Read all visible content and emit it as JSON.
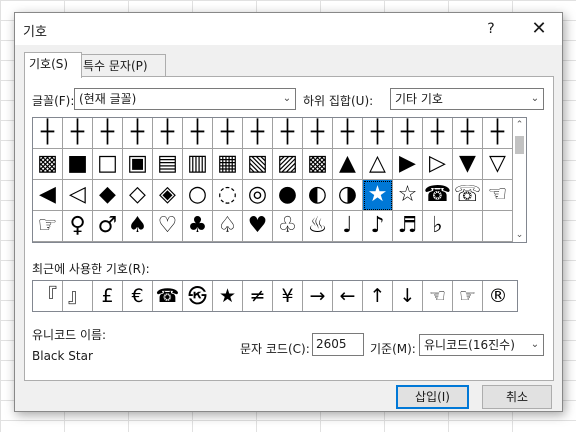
{
  "dialog": {
    "title": "기호",
    "help": "?",
    "close": "✕"
  },
  "tabs": [
    {
      "label": "기호(S)",
      "active": true
    },
    {
      "label": "특수 문자(P)",
      "active": false
    }
  ],
  "font": {
    "label": "글꼴(F):",
    "value": "(현재 글꼴)"
  },
  "subset": {
    "label": "하위 집합(U):",
    "value": "기타 기호"
  },
  "symbols": {
    "rows": [
      [
        "┼",
        "┼",
        "┼",
        "┼",
        "┼",
        "┼",
        "┼",
        "┼",
        "┼",
        "┼",
        "┼",
        "┼",
        "┼",
        "┼",
        "┼",
        "┼"
      ],
      [
        "▩",
        "■",
        "□",
        "▣",
        "▤",
        "▥",
        "▦",
        "▧",
        "▨",
        "▩",
        "▲",
        "△",
        "▶",
        "▷",
        "▼",
        "▽"
      ],
      [
        "◀",
        "◁",
        "◆",
        "◇",
        "◈",
        "○",
        "◌",
        "◎",
        "●",
        "◐",
        "◑",
        "★",
        "☆",
        "☎",
        "☏",
        "☜"
      ],
      [
        "☞",
        "♀",
        "♂",
        "♠",
        "♡",
        "♣",
        "♤",
        "♥",
        "♧",
        "♨",
        "♩",
        "♪",
        "♬",
        "♭",
        "",
        ""
      ]
    ],
    "selected": {
      "row": 2,
      "col": 11
    }
  },
  "recent": {
    "label": "최근에 사용한 기호(R):",
    "items": [
      "『",
      "』",
      "£",
      "€",
      "☎",
      "㉿",
      "★",
      "≠",
      "¥",
      "→",
      "←",
      "↑",
      "↓",
      "☜",
      "☞",
      "®"
    ]
  },
  "unicode_name": {
    "label": "유니코드 이름:",
    "value": "Black Star"
  },
  "char_code": {
    "label": "문자 코드(C):",
    "value": "2605"
  },
  "from": {
    "label": "기준(M):",
    "value": "유니코드(16진수)"
  },
  "buttons": {
    "insert": "삽입(I)",
    "cancel": "취소"
  },
  "colors": {
    "selection": "#0078d7",
    "dialog_bg": "#f0f0f0"
  }
}
